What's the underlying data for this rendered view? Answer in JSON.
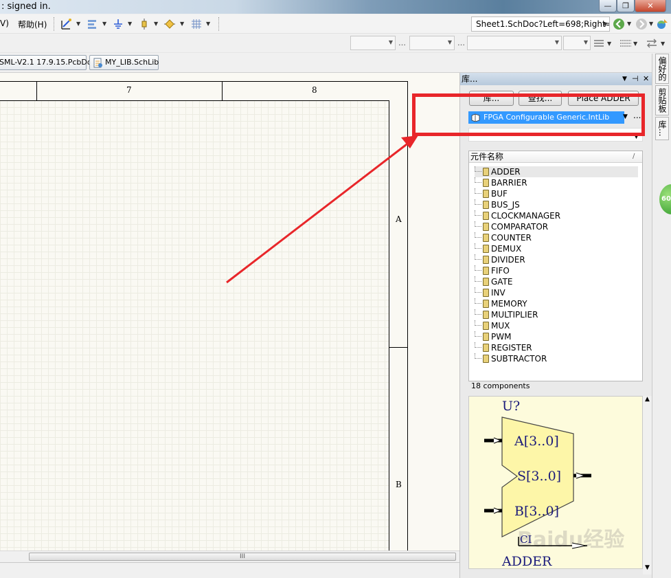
{
  "titlebar": {
    "status": ": signed in.",
    "minimize": "—",
    "maximize": "❐",
    "close": "✕"
  },
  "menu": {
    "items": [
      {
        "label": "V)"
      },
      {
        "label": "帮助(H)"
      }
    ],
    "address": "Sheet1.SchDoc?Left=698;Right="
  },
  "tabs": [
    {
      "label": "SML-V2.1 17.9.15.PcbDoc"
    },
    {
      "label": "MY_LIB.SchLib"
    }
  ],
  "sheet": {
    "zone_columns": [
      "7",
      "8"
    ],
    "zone_rows": [
      "A",
      "B"
    ],
    "scroll_grip": "III"
  },
  "library_panel": {
    "title": "库...",
    "buttons": {
      "libraries": "库...",
      "search": "查找...",
      "place": "Place ADDER"
    },
    "selected_library": "FPGA Configurable Generic.IntLib",
    "more": "...",
    "list_header": "元件名称",
    "sort_indicator": "/",
    "components": [
      "ADDER",
      "BARRIER",
      "BUF",
      "BUS_JS",
      "CLOCKMANAGER",
      "COMPARATOR",
      "COUNTER",
      "DEMUX",
      "DIVIDER",
      "FIFO",
      "GATE",
      "INV",
      "MEMORY",
      "MULTIPLIER",
      "MUX",
      "PWM",
      "REGISTER",
      "SUBTRACTOR"
    ],
    "selected_component": "ADDER",
    "component_count": "18 components",
    "preview": {
      "designator": "U?",
      "pin_a": "A[3..0]",
      "pin_s": "S[3..0]",
      "pin_b": "B[3..0]",
      "pin_ci": "CI",
      "name": "ADDER",
      "watermark": "Baidu经验"
    }
  },
  "dock_tabs": [
    "偏好的",
    "剪贴板",
    "库..."
  ],
  "badge": "60",
  "colors": {
    "highlight": "#e8262a",
    "selection": "#3399ff",
    "sheet_bg": "#faf9f3",
    "preview_bg": "#fdfbdc",
    "symbol_fill": "#fdf6a8",
    "symbol_text": "#1a1a7a"
  }
}
